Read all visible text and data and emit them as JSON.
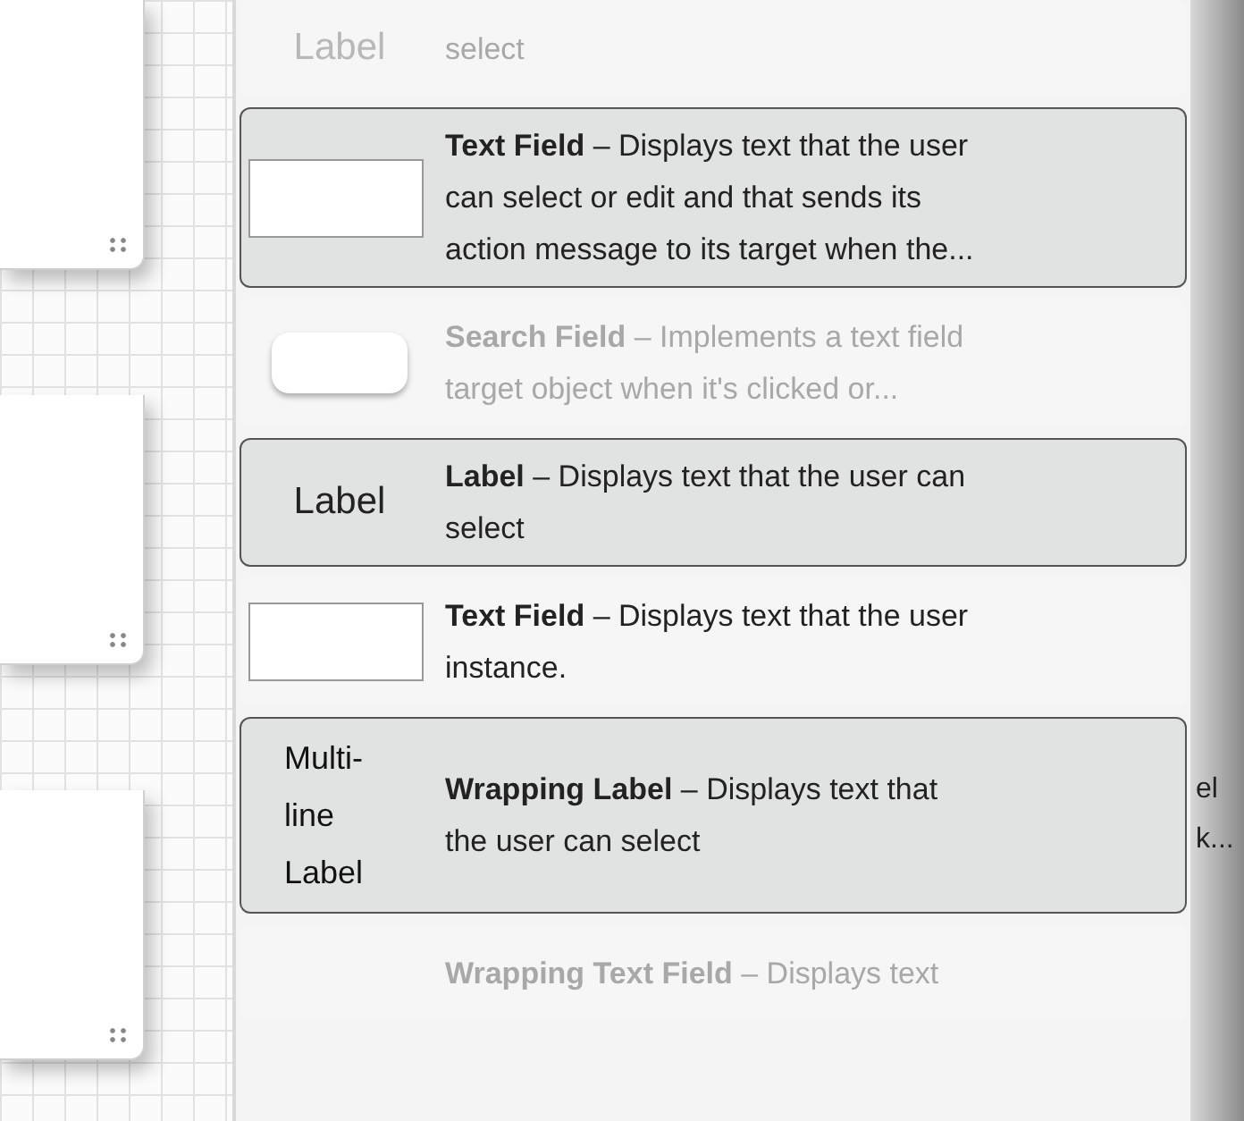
{
  "library_items": [
    {
      "preview": {
        "kind": "label",
        "text": "Label"
      },
      "lines": [
        "select"
      ],
      "selected": false,
      "faded": true
    },
    {
      "preview": {
        "kind": "text-field"
      },
      "lines": [
        "**Text Field** – Displays text that the user",
        "can select or edit and that sends its",
        "action message to its target when the..."
      ],
      "selected": true,
      "faded": false
    },
    {
      "preview": {
        "kind": "search-field"
      },
      "lines": [
        "**Search Field** – Implements a text field",
        "target object when it's clicked or..."
      ],
      "selected": false,
      "faded": true
    },
    {
      "preview": {
        "kind": "label",
        "text": "Label"
      },
      "lines": [
        "**Label** – Displays text that the user can",
        "select"
      ],
      "selected": true,
      "faded": false
    },
    {
      "preview": {
        "kind": "text-field"
      },
      "lines": [
        "**Text Field** – Displays text that the user",
        "instance."
      ],
      "selected": false,
      "faded": false
    },
    {
      "preview": {
        "kind": "wrapping-label",
        "text_lines": [
          "Multi-",
          "line",
          "Label"
        ]
      },
      "lines": [
        "**Wrapping Label** – Displays text that",
        "the user can select"
      ],
      "selected": true,
      "faded": false,
      "behind": [
        "el",
        "k..."
      ]
    },
    {
      "preview": {
        "kind": "none"
      },
      "lines": [
        "**Wrapping Text Field** – Displays text"
      ],
      "selected": false,
      "faded": true
    }
  ]
}
